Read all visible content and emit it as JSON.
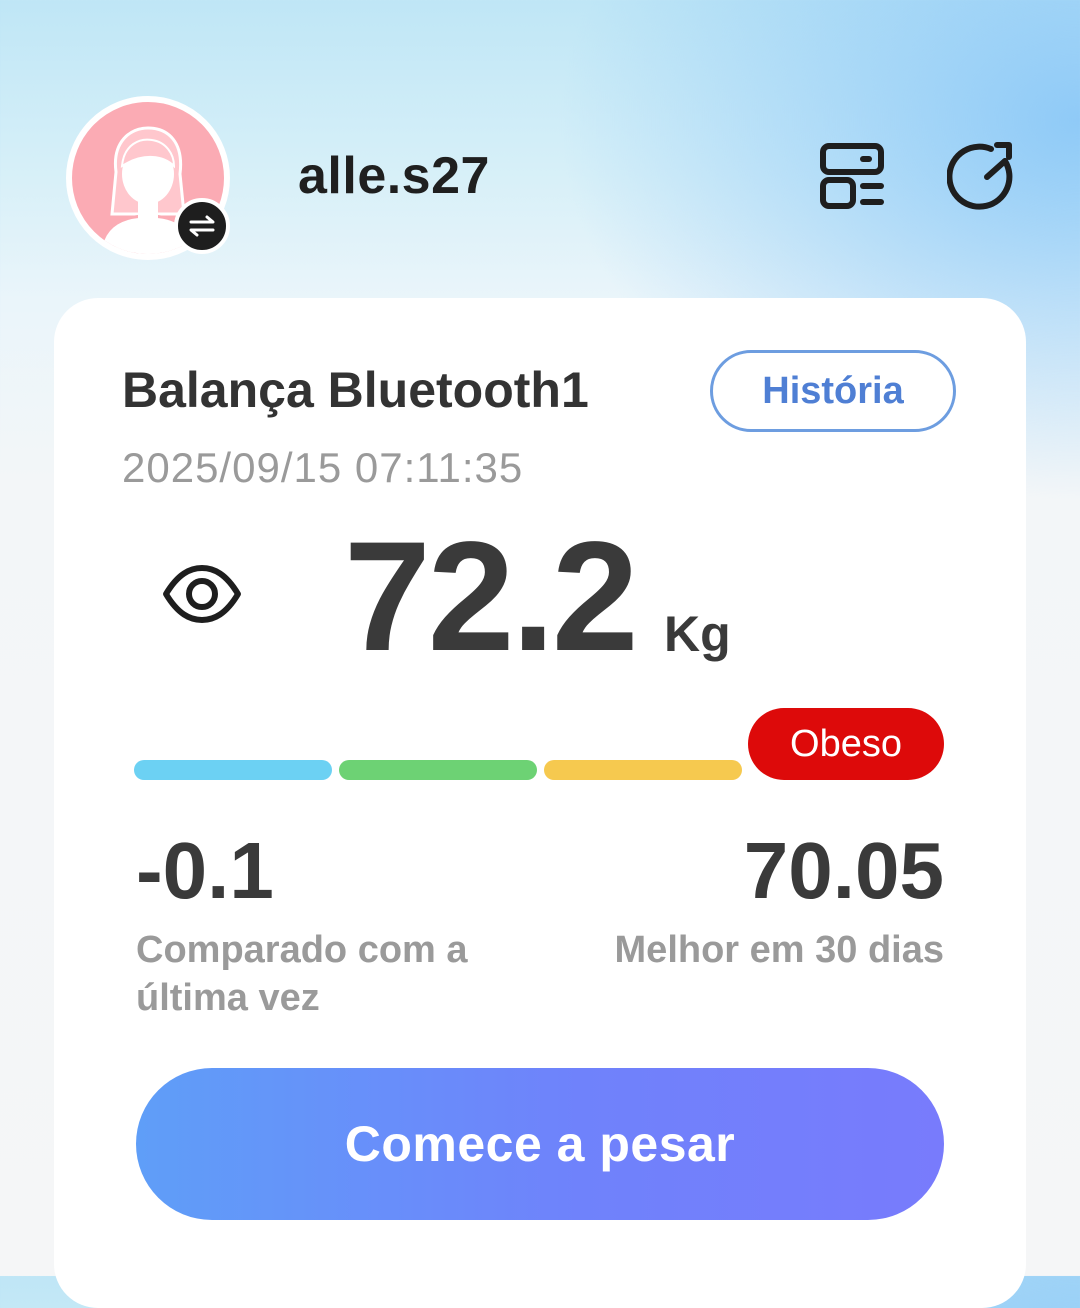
{
  "header": {
    "username": "alle.s27",
    "icons": {
      "device": "device-list-icon",
      "sync": "refresh-icon",
      "avatar": "female-avatar-icon",
      "switch": "switch-user-icon"
    }
  },
  "card": {
    "device_name": "Balança Bluetooth1",
    "history_label": "História",
    "timestamp": "2025/09/15 07:11:35",
    "weight": "72.2",
    "unit": "Kg",
    "status": "Obeso",
    "visibility_icon": "eye-icon",
    "bmi_segments": [
      {
        "color": "#6cd1f3"
      },
      {
        "color": "#6dd274"
      },
      {
        "color": "#f6c94f"
      },
      {
        "color": "#dd0a0a"
      }
    ],
    "change_value": "-0.1",
    "change_label": "Comparado com a última vez",
    "best_value": "70.05",
    "best_label": "Melhor em 30 dias",
    "start_label": "Comece a pesar"
  },
  "colors": {
    "accent": "#4f7fd4",
    "status_danger": "#dd0a0a",
    "button_gradient_start": "#5f9ef8",
    "button_gradient_end": "#787bfc"
  }
}
